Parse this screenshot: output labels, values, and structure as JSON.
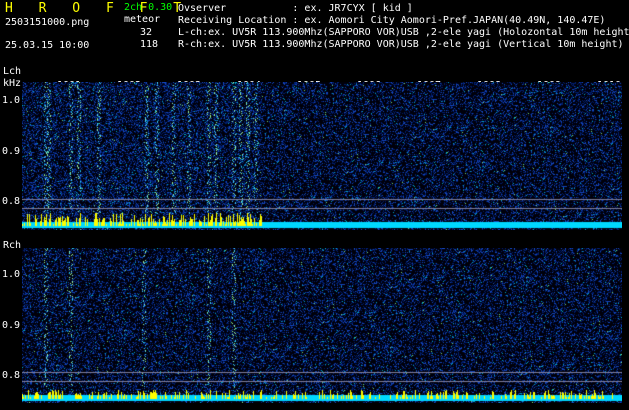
{
  "header": {
    "title": "H R O F F T",
    "mode": "2ch 0.30",
    "filename": "2503151000.png",
    "meteor_label": "meteor",
    "datetime": "25.03.15 10:00",
    "count_l": "32",
    "count_r": "118",
    "observer": "Ovserver           : ex. JR7CYX [ kid ]",
    "location": "Receiving Location : ex. Aomori City Aomori-Pref.JAPAN(40.49N, 140.47E)",
    "l_channel": "L-ch:ex. UV5R 113.900Mhz(SAPPORO VOR)USB ,2-ele yagi (Holozontal 10m height)",
    "r_channel": "R-ch:ex. UV5R 113.900Mhz(SAPPORO VOR)USB ,2-ele yagi (Vertical 10m height)"
  },
  "axes": {
    "lch_label": "Lch",
    "khz_label": "kHz",
    "rch_label": "Rch",
    "freq_ticks": [
      "1.0",
      "0.9",
      "0.8"
    ],
    "minute_ticks": [
      "1001",
      "1002",
      "1003",
      "1004",
      "1005",
      "1006",
      "1007",
      "1008",
      "1009",
      "1010"
    ]
  },
  "colors": {
    "text_green": "#00ff00",
    "text_white": "#ffffff",
    "text_yellow": "#ffff00",
    "echo_cyan": "#00e0ff",
    "meteor_yellow": "#ffff00",
    "noise_blue": "#1840c0"
  }
}
